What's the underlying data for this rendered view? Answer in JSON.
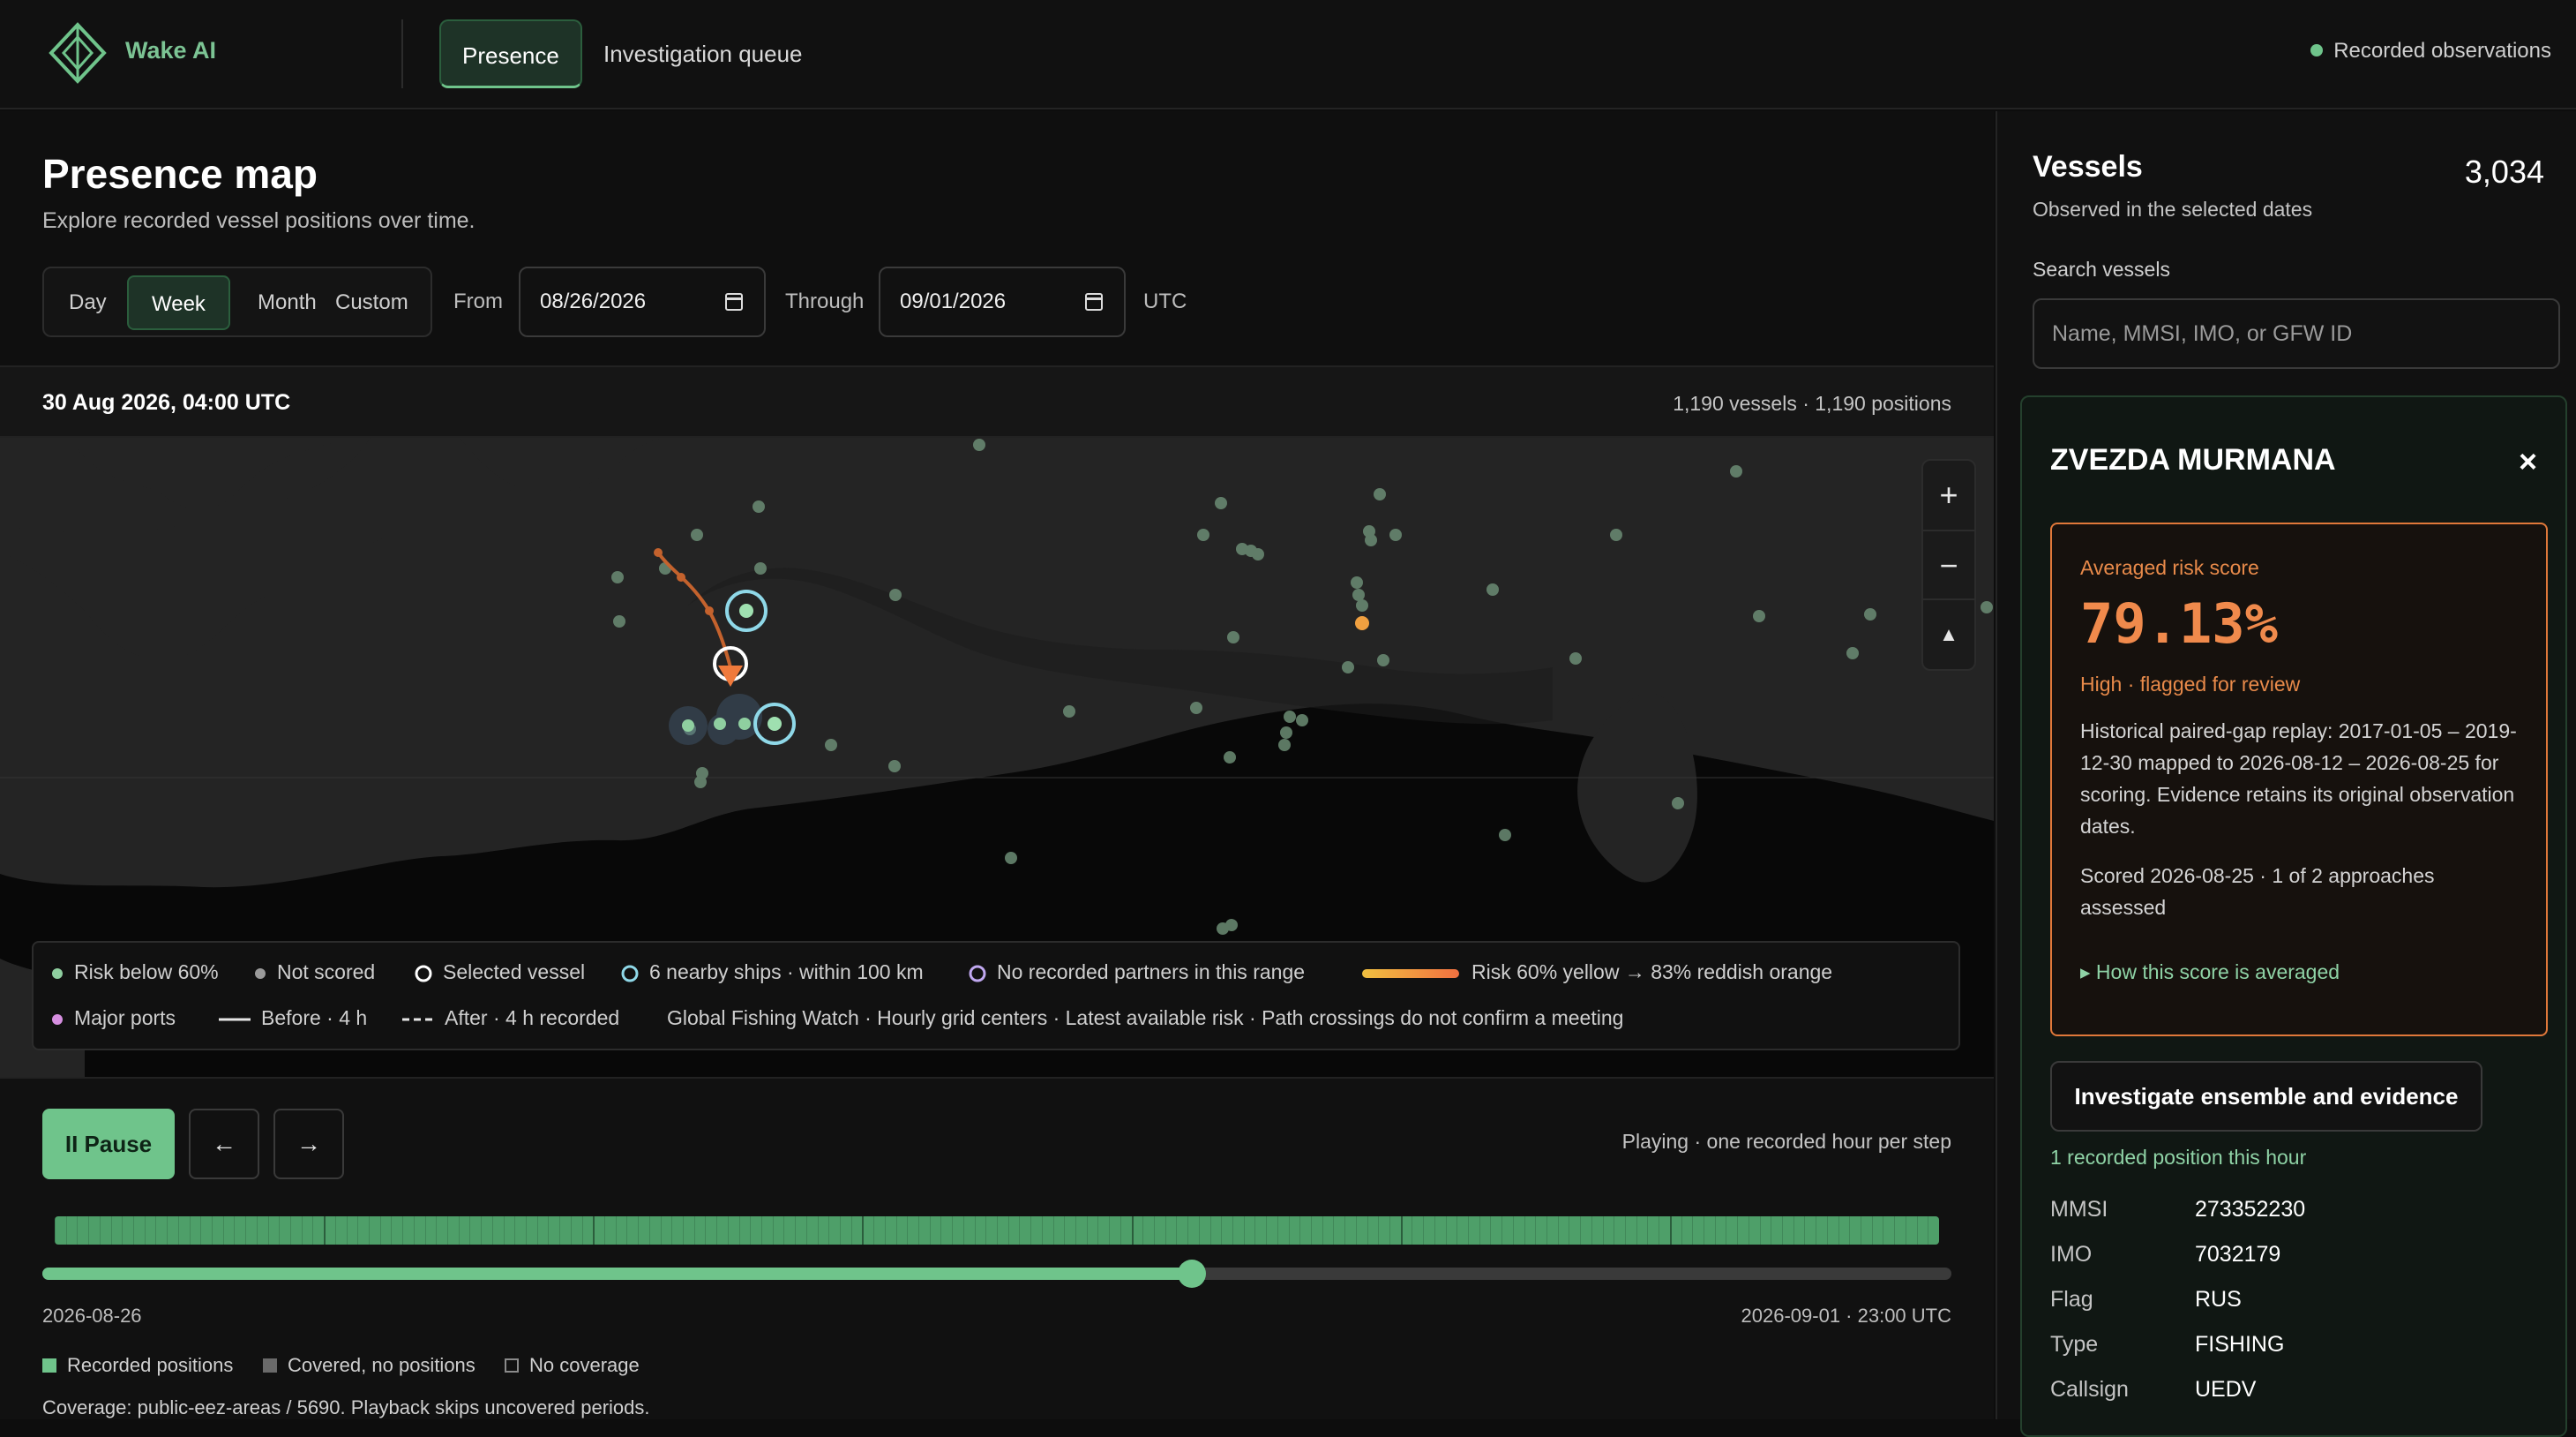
{
  "app": {
    "brand": "Wake AI"
  },
  "nav": {
    "tabs": [
      {
        "label": "Presence",
        "active": true
      },
      {
        "label": "Investigation queue",
        "active": false
      }
    ],
    "status": "Recorded observations"
  },
  "page": {
    "title": "Presence map",
    "subtitle": "Explore recorded vessel positions over time."
  },
  "range": {
    "options": [
      "Day",
      "Week",
      "Month",
      "Custom"
    ],
    "selected": "Week",
    "from_label": "From",
    "from_value": "08/26/2026",
    "through_label": "Through",
    "through_value": "09/01/2026",
    "tz": "UTC"
  },
  "map": {
    "timestamp": "30 Aug 2026, 04:00 UTC",
    "counts": "1,190 vessels · 1,190 positions",
    "zoom_in": "+",
    "zoom_out": "−"
  },
  "legend": {
    "risk_below": "Risk below 60%",
    "not_scored": "Not scored",
    "selected": "Selected vessel",
    "nearby": "6 nearby ships · within 100 km",
    "no_partners": "No recorded partners in this range",
    "risk_gradient": "Risk 60% yellow → 83% reddish orange",
    "ports": "Major ports",
    "before": "Before · 4 h",
    "after": "After · 4 h recorded",
    "source": "Global Fishing Watch · Hourly grid centers · Latest available risk · Path crossings do not confirm a meeting"
  },
  "playback": {
    "pause_label": "II Pause",
    "prev_icon": "←",
    "next_icon": "→",
    "status": "Playing · one recorded hour per step",
    "progress": 0.602,
    "start": "2026-08-26",
    "end": "2026-09-01 · 23:00 UTC",
    "legend_recorded": "Recorded positions",
    "legend_covered": "Covered, no positions",
    "legend_none": "No coverage",
    "coverage_note": "Coverage: public-eez-areas / 5690. Playback skips uncovered periods."
  },
  "sidebar": {
    "title": "Vessels",
    "count": "3,034",
    "subtitle": "Observed in the selected dates",
    "search_label": "Search vessels",
    "search_placeholder": "Name, MMSI, IMO, or GFW ID"
  },
  "vessel": {
    "name": "ZVEZDA MURMANA",
    "close_icon": "×",
    "risk_label": "Averaged risk score",
    "risk_value": "79.13%",
    "risk_level": "High · flagged for review",
    "risk_description": "Historical paired-gap replay: 2017-01-05 – 2019-12-30 mapped to 2026-08-12 – 2026-08-25 for scoring. Evidence retains its original observation dates.",
    "scored": "Scored 2026-08-25 · 1 of 2 approaches assessed",
    "how_label": "▸ How this score is averaged",
    "investigate_label": "Investigate ensemble and evidence",
    "recorded_positions": "1 recorded position this hour",
    "details": [
      {
        "key": "MMSI",
        "value": "273352230"
      },
      {
        "key": "IMO",
        "value": "7032179"
      },
      {
        "key": "Flag",
        "value": "RUS"
      },
      {
        "key": "Type",
        "value": "FISHING"
      },
      {
        "key": "Callsign",
        "value": "UEDV"
      }
    ]
  },
  "colors": {
    "accent": "#6fc48b",
    "risk": "#f08a4c",
    "selected_ring": "#8fd8e8",
    "background": "#0f0f0f"
  }
}
